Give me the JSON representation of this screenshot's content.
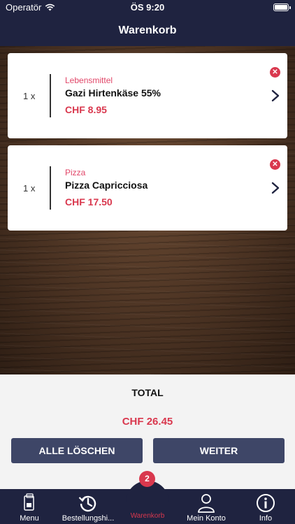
{
  "status_bar": {
    "carrier": "Operatör",
    "time": "ÖS 9:20"
  },
  "header": {
    "title": "Warenkorb"
  },
  "cart_items": [
    {
      "quantity": "1 x",
      "category": "Lebensmittel",
      "name": "Gazi Hirtenkäse 55%",
      "price": "CHF 8.95"
    },
    {
      "quantity": "1 x",
      "category": "Pizza",
      "name": "Pizza Capricciosa",
      "price": "CHF 17.50"
    }
  ],
  "summary": {
    "total_label": "TOTAL",
    "total_value": "CHF 26.45"
  },
  "actions": {
    "clear_label": "ALLE LÖSCHEN",
    "next_label": "WEITER"
  },
  "tabbar": {
    "cart_badge": "2",
    "tabs": [
      {
        "label": "Menu",
        "icon": "menu-card-icon"
      },
      {
        "label": "Bestellungshi...",
        "icon": "history-icon"
      },
      {
        "label": "Warenkorb",
        "icon": "basket-icon",
        "active": true
      },
      {
        "label": "Mein Konto",
        "icon": "user-icon"
      },
      {
        "label": "Info",
        "icon": "info-icon"
      }
    ]
  },
  "colors": {
    "navy": "#1f2340",
    "accent_red": "#d9384e",
    "button": "#3e4667"
  }
}
